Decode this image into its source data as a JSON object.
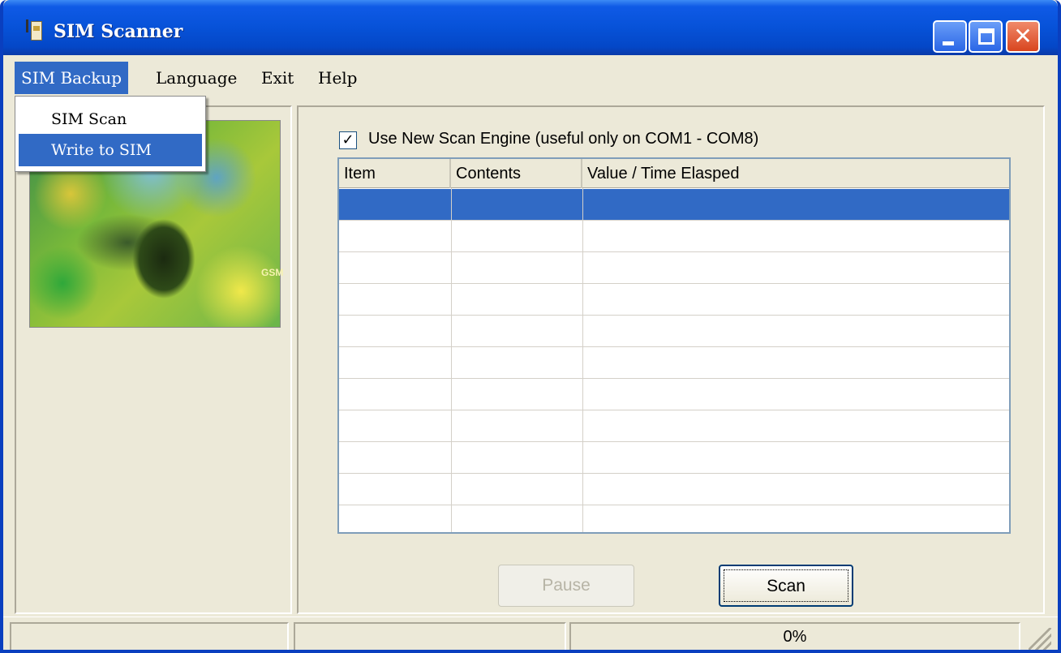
{
  "window": {
    "title": "SIM Scanner"
  },
  "menu": {
    "sim_backup": "SIM Backup",
    "language": "Language",
    "exit": "Exit",
    "help": "Help"
  },
  "dropdown": {
    "sim_scan": "SIM Scan",
    "write_to_sim": "Write to SIM"
  },
  "image": {
    "label": "GSM"
  },
  "options": {
    "use_new_scan_engine": "Use New Scan Engine (useful only on COM1 - COM8)",
    "use_new_scan_engine_checked": true
  },
  "table": {
    "columns": [
      "Item",
      "Contents",
      "Value / Time Elasped"
    ],
    "selected_row": 0
  },
  "buttons": {
    "pause": "Pause",
    "scan": "Scan"
  },
  "status": {
    "progress": "0%"
  },
  "colors": {
    "titlebar": "#0752d8",
    "selection": "#316ac5",
    "face": "#ece9d8"
  }
}
